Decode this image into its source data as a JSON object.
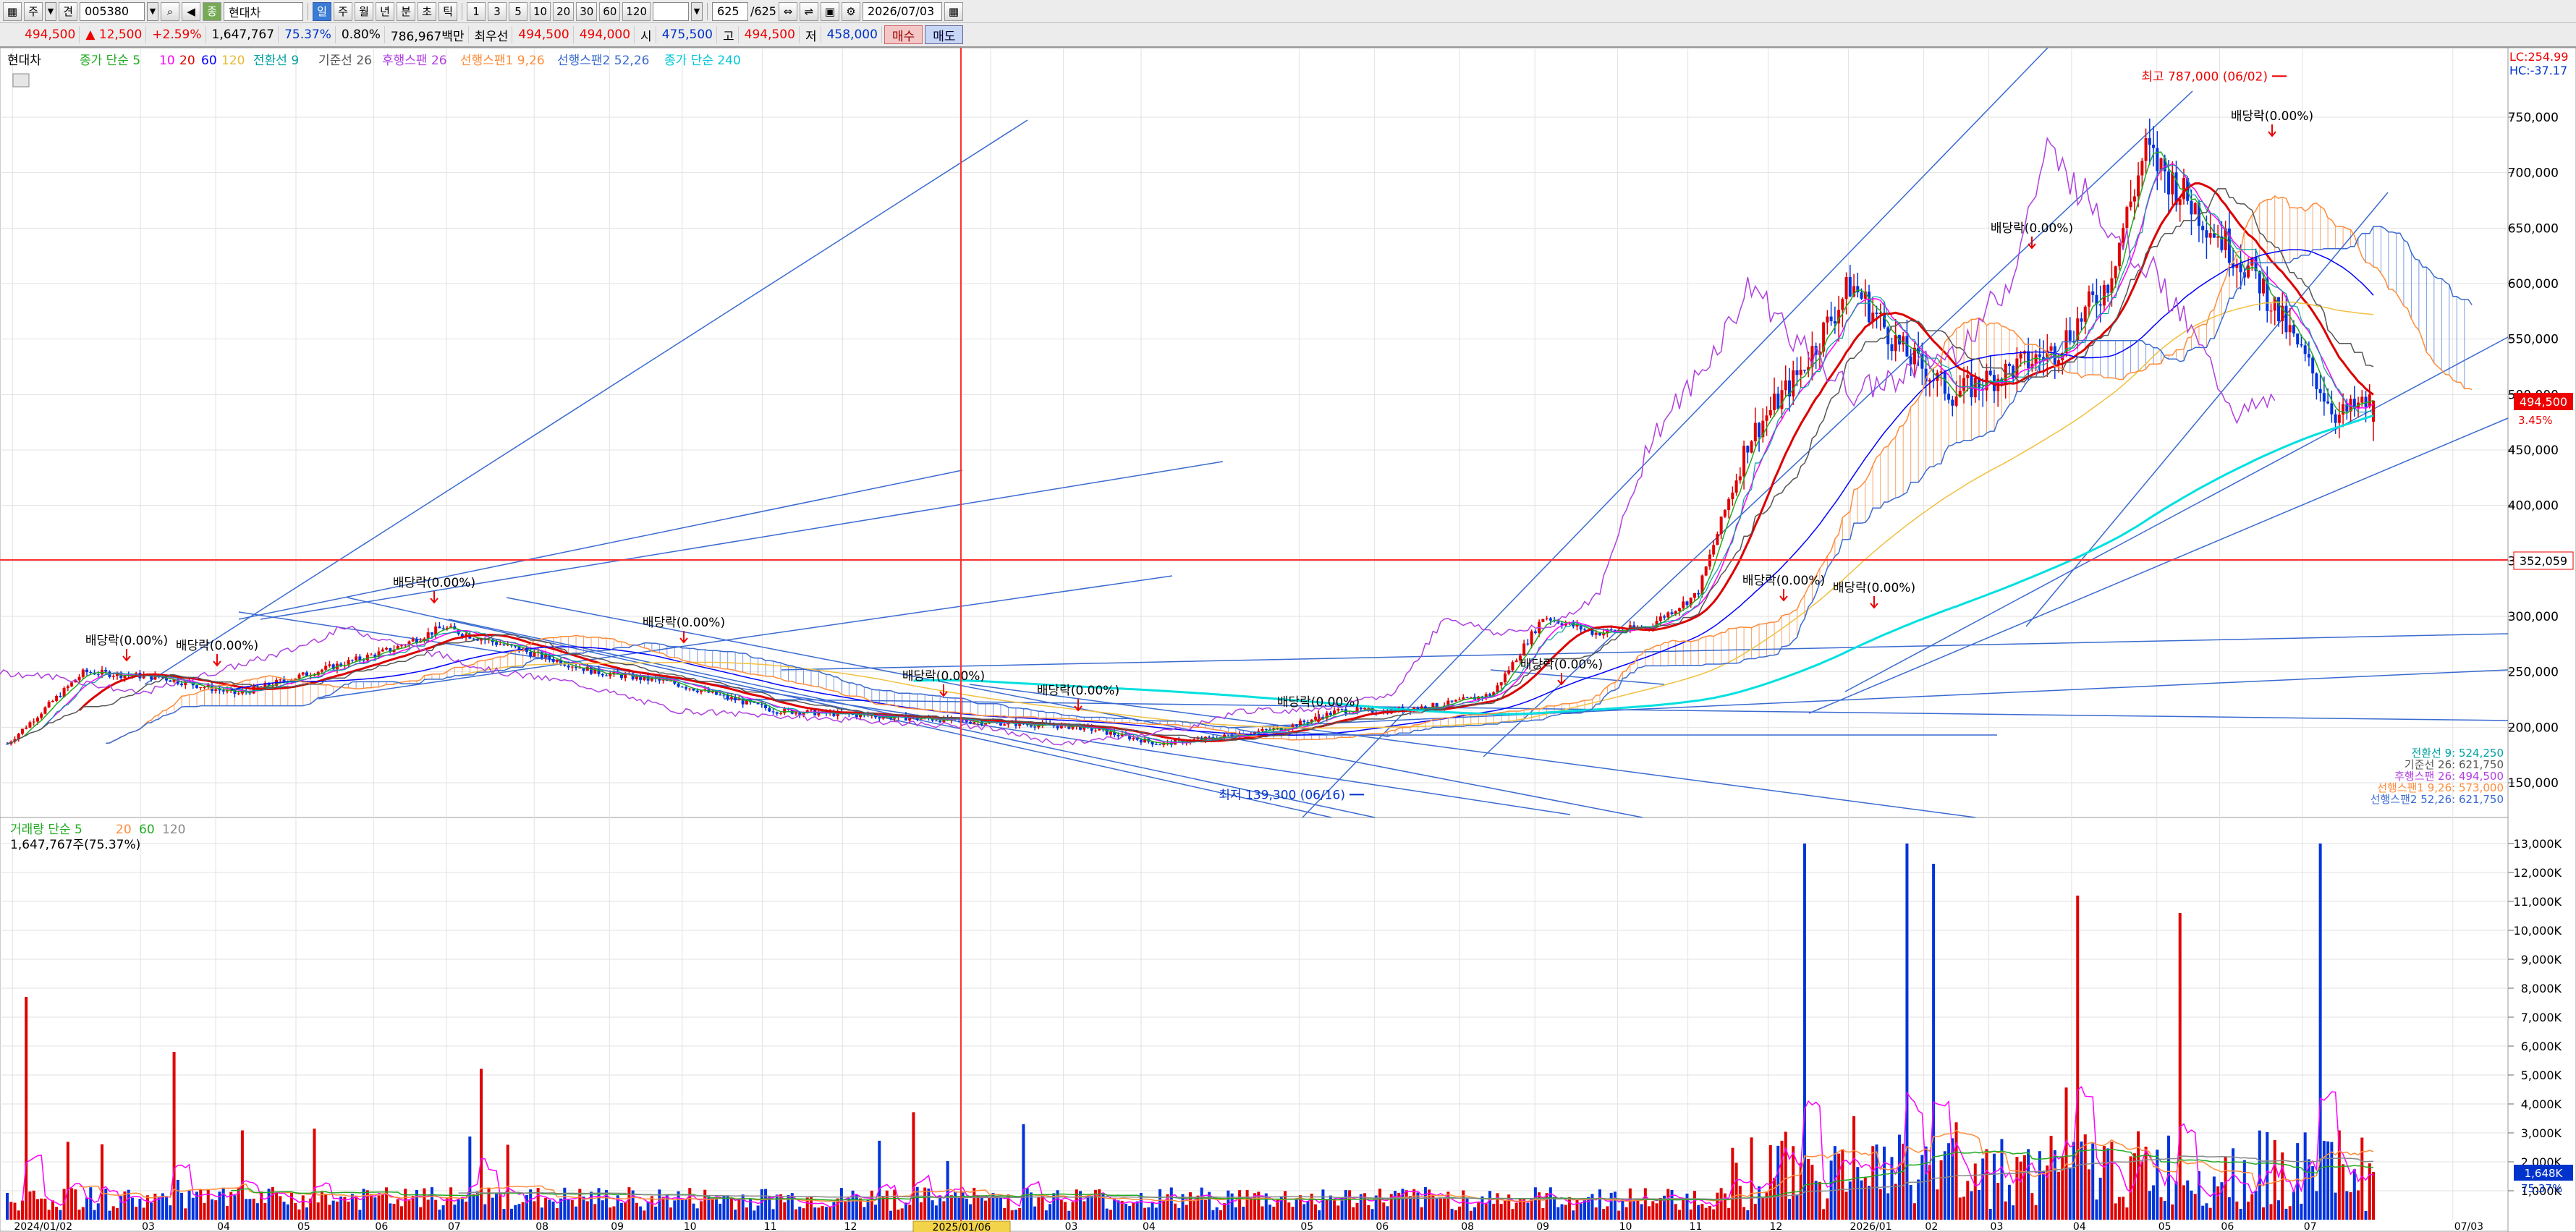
{
  "toolbar": {
    "view_label": "주",
    "mode_label": "견",
    "code": "005380",
    "name": "현대차",
    "periods": [
      "일",
      "주",
      "월",
      "년",
      "분",
      "초",
      "틱"
    ],
    "active_period": "일",
    "minutes": [
      "1",
      "3",
      "5",
      "10",
      "20",
      "30",
      "60",
      "120"
    ],
    "count_value": "625",
    "count_total": "/625",
    "date": "2026/07/03"
  },
  "quote": {
    "price": "494,500",
    "change": "▲ 12,500",
    "change_pct": "+2.59%",
    "volume": "1,647,767",
    "vol_ratio": "75.37%",
    "turnover": "0.80%",
    "amount": "786,967백만",
    "hoga_label": "최우선",
    "ask": "494,500",
    "bid": "494,000",
    "open_label": "시",
    "open": "475,500",
    "high_label": "고",
    "high": "494,500",
    "low_label": "저",
    "low": "458,000",
    "buy_label": "매수",
    "sell_label": "매도"
  },
  "legend": {
    "name": "현대차",
    "ma": "종가 단순 5",
    "ma10": "10",
    "ma20": "20",
    "ma60": "60",
    "ma120": "120",
    "conv": "전환선 9",
    "base": "기준선 26",
    "lag": "후행스팬 26",
    "lead1": "선행스팬1 9,26",
    "lead2": "선행스팬2 52,26",
    "ma240": "종가 단순 240"
  },
  "corner": {
    "lc": "LC:254.99",
    "hc": "HC:-37.17"
  },
  "price_axis": [
    "750,000",
    "700,000",
    "650,000",
    "600,000",
    "550,000",
    "500,000",
    "450,000",
    "400,000",
    "350,000",
    "300,000",
    "250,000",
    "200,000",
    "150,000"
  ],
  "price_tag": "494,500",
  "price_tag_pct": "3.45%",
  "crosshair_tag": "352,059",
  "annotations": {
    "high": "최고 787,000 (06/02)",
    "low": "최저 139,300 (06/16)",
    "dividend": "배당락(0.00%)"
  },
  "ichimoku_values": [
    "전환선 9: 524,250",
    "기준선 26: 621,750",
    "후행스팬 26: 494,500",
    "선행스팬1 9,26: 573,000",
    "선행스팬2 52,26: 621,750"
  ],
  "volume_legend": {
    "label": "거래량 단순 5",
    "v20": "20",
    "v60": "60",
    "v120": "120",
    "current": "1,647,767주(75.37%)"
  },
  "volume_axis": [
    "13,000K",
    "12,000K",
    "11,000K",
    "10,000K",
    "9,000K",
    "8,000K",
    "7,000K",
    "6,000K",
    "5,000K",
    "4,000K",
    "3,000K",
    "2,000K",
    "1,000K"
  ],
  "volume_tag": "1,648K",
  "volume_tag_pct": "75.37%",
  "x_axis": [
    {
      "label": "2024/01/02",
      "x": 0.005
    },
    {
      "label": "03",
      "x": 0.056
    },
    {
      "label": "04",
      "x": 0.086
    },
    {
      "label": "05",
      "x": 0.118
    },
    {
      "label": "06",
      "x": 0.149
    },
    {
      "label": "07",
      "x": 0.178
    },
    {
      "label": "08",
      "x": 0.213
    },
    {
      "label": "09",
      "x": 0.243
    },
    {
      "label": "10",
      "x": 0.272
    },
    {
      "label": "11",
      "x": 0.304
    },
    {
      "label": "12",
      "x": 0.336
    },
    {
      "label": "02",
      "x": 0.395
    },
    {
      "label": "03",
      "x": 0.424
    },
    {
      "label": "04",
      "x": 0.455
    },
    {
      "label": "05",
      "x": 0.518
    },
    {
      "label": "06",
      "x": 0.548
    },
    {
      "label": "08",
      "x": 0.582
    },
    {
      "label": "09",
      "x": 0.612
    },
    {
      "label": "10",
      "x": 0.645
    },
    {
      "label": "11",
      "x": 0.673
    },
    {
      "label": "12",
      "x": 0.705
    },
    {
      "label": "2026/01",
      "x": 0.737
    },
    {
      "label": "02",
      "x": 0.767
    },
    {
      "label": "03",
      "x": 0.793
    },
    {
      "label": "04",
      "x": 0.826
    },
    {
      "label": "05",
      "x": 0.86
    },
    {
      "label": "06",
      "x": 0.885
    },
    {
      "label": "07",
      "x": 0.918
    },
    {
      "label": "07/03",
      "x": 0.978
    }
  ],
  "x_cursor_tag": "2025/01/06",
  "chart_data": {
    "type": "candlestick",
    "title": "현대차 (005380) 일봉",
    "ylim": [
      120000,
      800000
    ],
    "current": 494500,
    "highest": {
      "value": 787000,
      "date": "06/02"
    },
    "lowest": {
      "value": 139300,
      "date": "06/16"
    },
    "volume_ylim": [
      0,
      13500000
    ],
    "colors": {
      "up": "#e00000",
      "down": "#0033dd",
      "ma5": "#22aa22",
      "ma10": "#ff00ff",
      "ma20": "#dd0000",
      "ma60": "#0000ff",
      "ma120": "#f0c040",
      "ma240": "#00e0e0",
      "conv": "#00a0a0",
      "base": "#555555",
      "lag": "#b040e0",
      "lead1": "#ff8c3a",
      "lead2": "#3a6ad0"
    }
  }
}
